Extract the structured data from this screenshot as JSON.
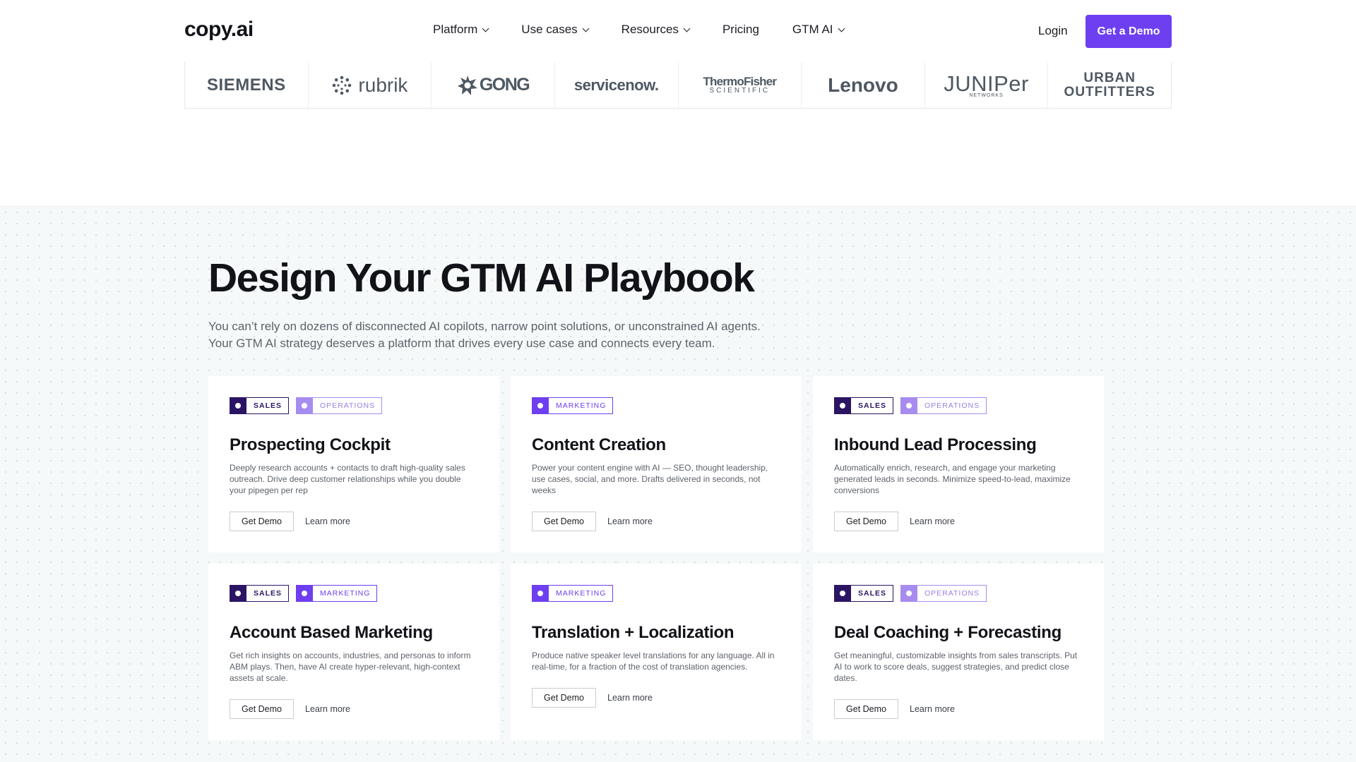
{
  "header": {
    "logo": "copy.ai",
    "nav": [
      {
        "label": "Platform",
        "dropdown": true
      },
      {
        "label": "Use cases",
        "dropdown": true
      },
      {
        "label": "Resources",
        "dropdown": true
      },
      {
        "label": "Pricing",
        "dropdown": false
      },
      {
        "label": "GTM AI",
        "dropdown": true
      }
    ],
    "login": "Login",
    "cta": "Get a Demo"
  },
  "brands": {
    "siemens": "SIEMENS",
    "rubrik": "rubrik",
    "gong": "GONG",
    "servicenow": "servicenow.",
    "thermo_top": "ThermoFisher",
    "thermo_bottom": "SCIENTIFIC",
    "lenovo": "Lenovo",
    "juniper_top": "JUNIPer",
    "juniper_bottom": "NETWORKS",
    "urban_top": "URBAN",
    "urban_bottom": "OUTFITTERS"
  },
  "section": {
    "title": "Design Your GTM AI Playbook",
    "subtitle_line1": "You can’t rely on dozens of disconnected AI copilots, narrow point solutions, or unconstrained AI agents.",
    "subtitle_line2": "Your GTM AI strategy deserves a platform that drives every use case and connects every team."
  },
  "tags": {
    "sales": "SALES",
    "operations": "OPERATIONS",
    "marketing": "MARKETING"
  },
  "cards": [
    {
      "title": "Prospecting Cockpit",
      "desc": "Deeply research accounts + contacts to draft high-quality sales outreach. Drive deep customer relationships while you double your pipegen per rep",
      "primary": "Get Demo",
      "secondary": "Learn more"
    },
    {
      "title": "Content Creation",
      "desc": "Power your content engine with AI — SEO, thought leadership, use cases, social, and more. Drafts delivered in seconds, not weeks",
      "primary": "Get Demo",
      "secondary": "Learn more"
    },
    {
      "title": "Inbound Lead Processing",
      "desc": "Automatically enrich, research, and engage your marketing generated leads in seconds. Minimize speed-to-lead, maximize conversions",
      "primary": "Get Demo",
      "secondary": "Learn more"
    },
    {
      "title": "Account Based Marketing",
      "desc": "Get rich insights on accounts, industries, and personas to inform ABM plays. Then, have AI create hyper-relevant, high-context assets at scale.",
      "primary": "Get Demo",
      "secondary": "Learn more"
    },
    {
      "title": "Translation + Localization",
      "desc": "Produce native speaker level translations for any language. All in real-time, for a fraction of the cost of translation agencies.",
      "primary": "Get Demo",
      "secondary": "Learn more"
    },
    {
      "title": "Deal Coaching + Forecasting",
      "desc": "Get meaningful, customizable insights from sales transcripts. Put AI to work to score deals, suggest strategies, and predict close dates.",
      "primary": "Get Demo",
      "secondary": "Learn more"
    }
  ],
  "colors": {
    "brand_purple": "#6d3ff0",
    "sales_tag": "#2b1463",
    "operations_tag": "#a78cf0",
    "marketing_tag": "#6d3ff0",
    "section_bg": "#f6f9f9"
  }
}
